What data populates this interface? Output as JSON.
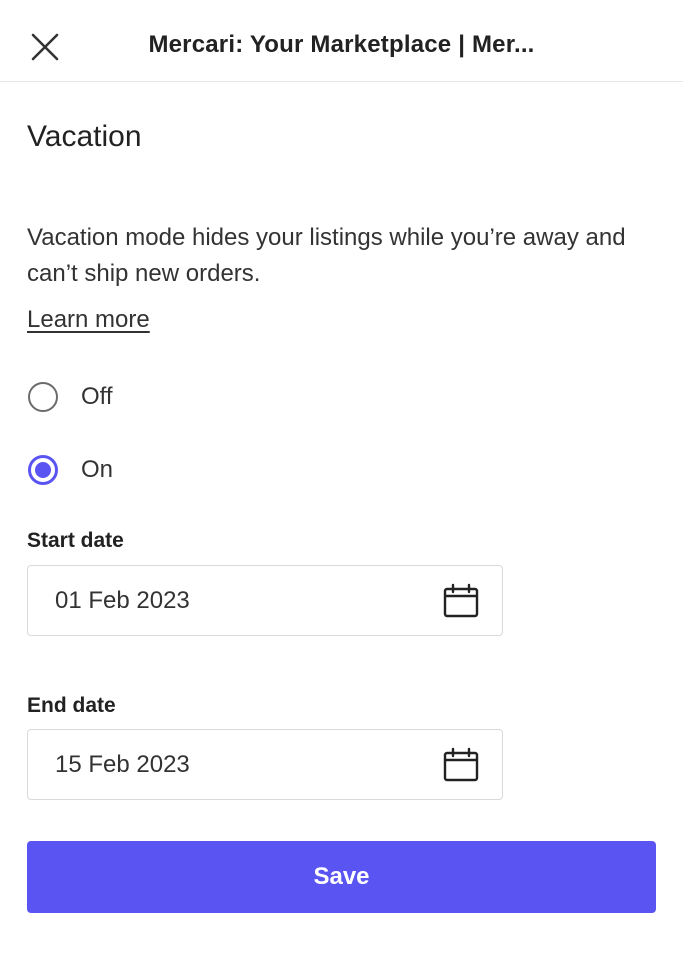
{
  "header": {
    "title": "Mercari: Your Marketplace | Mer...",
    "close_icon": "close-icon"
  },
  "page": {
    "heading": "Vacation",
    "description": "Vacation mode hides your listings while you’re away and can’t ship new orders.",
    "learn_more": "Learn more"
  },
  "vacation_mode": {
    "selected": "On",
    "options": [
      {
        "label": "Off",
        "checked": false
      },
      {
        "label": "On",
        "checked": true
      }
    ]
  },
  "start_date": {
    "label": "Start date",
    "value": "01 Feb 2023",
    "icon": "calendar-icon"
  },
  "end_date": {
    "label": "End date",
    "value": "15 Feb 2023",
    "icon": "calendar-icon"
  },
  "actions": {
    "save_label": "Save"
  },
  "colors": {
    "accent": "#5a55f2",
    "text": "#222222",
    "border": "#d9d9d9"
  }
}
